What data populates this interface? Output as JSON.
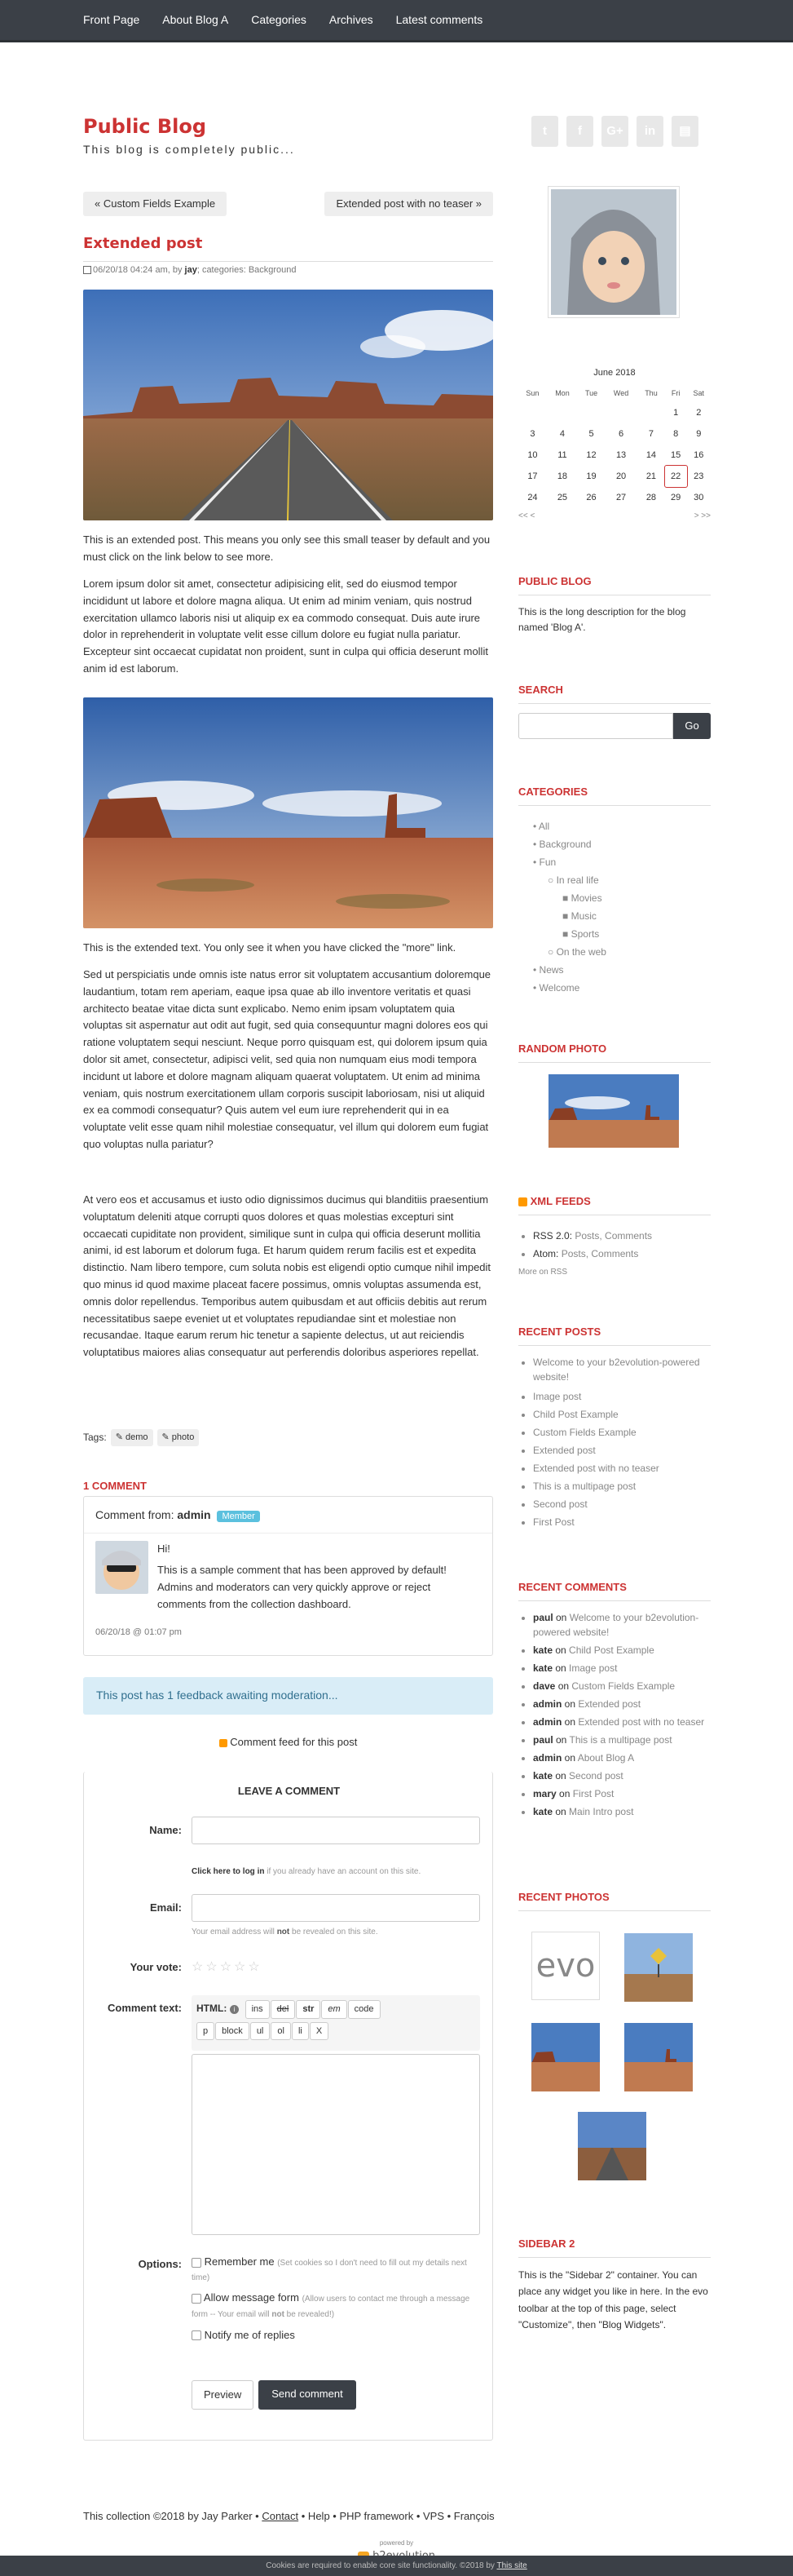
{
  "nav": {
    "items": [
      "Front Page",
      "About Blog A",
      "Categories",
      "Archives",
      "Latest comments"
    ]
  },
  "header": {
    "title": "Public Blog",
    "subtitle": "This blog is completely public..."
  },
  "social": [
    "twitter-icon",
    "facebook-icon",
    "googleplus-icon",
    "linkedin-icon",
    "print-icon"
  ],
  "pagenav": {
    "prev": "« Custom Fields Example",
    "next": "Extended post with no teaser »"
  },
  "post": {
    "title": "Extended post",
    "meta_date": "06/20/18 04:24 am, by ",
    "meta_author": "jay",
    "meta_cat_label": "; categories: ",
    "meta_cat": "Background",
    "teaser": "This is an extended post. This means you only see this small teaser by default and you must click on the link below to see more.",
    "lorem1": "Lorem ipsum dolor sit amet, consectetur adipisicing elit, sed do eiusmod tempor incididunt ut labore et dolore magna aliqua. Ut enim ad minim veniam, quis nostrud exercitation ullamco laboris nisi ut aliquip ex ea commodo consequat. Duis aute irure dolor in reprehenderit in voluptate velit esse cillum dolore eu fugiat nulla pariatur. Excepteur sint occaecat cupidatat non proident, sunt in culpa qui officia deserunt mollit anim id est laborum.",
    "extended": "This is the extended text. You only see it when you have clicked the \"more\" link.",
    "sed": "Sed ut perspiciatis unde omnis iste natus error sit voluptatem accusantium doloremque laudantium, totam rem aperiam, eaque ipsa quae ab illo inventore veritatis et quasi architecto beatae vitae dicta sunt explicabo. Nemo enim ipsam voluptatem quia voluptas sit aspernatur aut odit aut fugit, sed quia consequuntur magni dolores eos qui ratione voluptatem sequi nesciunt. Neque porro quisquam est, qui dolorem ipsum quia dolor sit amet, consectetur, adipisci velit, sed quia non numquam eius modi tempora incidunt ut labore et dolore magnam aliquam quaerat voluptatem. Ut enim ad minima veniam, quis nostrum exercitationem ullam corporis suscipit laboriosam, nisi ut aliquid ex ea commodi consequatur? Quis autem vel eum iure reprehenderit qui in ea voluptate velit esse quam nihil molestiae consequatur, vel illum qui dolorem eum fugiat quo voluptas nulla pariatur?",
    "at_vero": "At vero eos et accusamus et iusto odio dignissimos ducimus qui blanditiis praesentium voluptatum deleniti atque corrupti quos dolores et quas molestias excepturi sint occaecati cupiditate non provident, similique sunt in culpa qui officia deserunt mollitia animi, id est laborum et dolorum fuga. Et harum quidem rerum facilis est et expedita distinctio. Nam libero tempore, cum soluta nobis est eligendi optio cumque nihil impedit quo minus id quod maxime placeat facere possimus, omnis voluptas assumenda est, omnis dolor repellendus. Temporibus autem quibusdam et aut officiis debitis aut rerum necessitatibus saepe eveniet ut et voluptates repudiandae sint et molestiae non recusandae. Itaque earum rerum hic tenetur a sapiente delectus, ut aut reiciendis voluptatibus maiores alias consequatur aut perferendis doloribus asperiores repellat.",
    "tags_label": "Tags:",
    "tags": [
      "demo",
      "photo"
    ]
  },
  "comments": {
    "heading": "1 COMMENT",
    "from_label": "Comment from: ",
    "author": "admin",
    "badge": "Member",
    "hi": "Hi!",
    "body": "This is a sample comment that has been approved by default! Admins and moderators can very quickly approve or reject comments from the collection dashboard.",
    "date": "06/20/18 @ 01:07 pm",
    "moderation": "This post has 1 feedback awaiting moderation...",
    "feed": "Comment feed for this post"
  },
  "form": {
    "heading": "LEAVE A COMMENT",
    "name_label": "Name:",
    "login_link": "Click here to log in",
    "login_hint": " if you already have an account on this site.",
    "email_label": "Email:",
    "email_hint_pre": "Your email address will ",
    "email_hint_not": "not",
    "email_hint_post": " be revealed on this site.",
    "vote_label": "Your vote:",
    "comment_label": "Comment text:",
    "html_label": "HTML:",
    "toolbar1": [
      "ins",
      "del",
      "str",
      "em",
      "code"
    ],
    "toolbar2": [
      "p",
      "block",
      "ul",
      "ol",
      "li",
      "X"
    ],
    "options_label": "Options:",
    "opt1": "Remember me",
    "opt1_hint": "(Set cookies so I don't need to fill out my details next time)",
    "opt2": "Allow message form",
    "opt2_hint": "(Allow users to contact me through a message form -- Your email will ",
    "opt2_hint_not": "not",
    "opt2_hint_post": " be revealed!)",
    "opt3": "Notify me of replies",
    "preview": "Preview",
    "send": "Send comment"
  },
  "calendar": {
    "title": "June 2018",
    "days": [
      "Sun",
      "Mon",
      "Tue",
      "Wed",
      "Thu",
      "Fri",
      "Sat"
    ],
    "weeks": [
      [
        "",
        "",
        "",
        "",
        "",
        "1",
        "2"
      ],
      [
        "3",
        "4",
        "5",
        "6",
        "7",
        "8",
        "9"
      ],
      [
        "10",
        "11",
        "12",
        "13",
        "14",
        "15",
        "16"
      ],
      [
        "17",
        "18",
        "19",
        "20",
        "21",
        "22",
        "23"
      ],
      [
        "24",
        "25",
        "26",
        "27",
        "28",
        "29",
        "30"
      ]
    ],
    "today": "22",
    "prev": "<<  <",
    "next": ">  >>"
  },
  "sidebar": {
    "public_blog_h": "PUBLIC BLOG",
    "public_blog_text": "This is the long description for the blog named 'Blog A'.",
    "search_h": "SEARCH",
    "search_btn": "Go",
    "categories_h": "CATEGORIES",
    "categories": [
      "All",
      "Background",
      "Fun",
      "In real life",
      "Movies",
      "Music",
      "Sports",
      "On the web",
      "News",
      "Welcome"
    ],
    "random_photo_h": "RANDOM PHOTO",
    "xml_h": "XML FEEDS",
    "rss_label": "RSS 2.0: ",
    "atom_label": "Atom: ",
    "posts": "Posts",
    "comments": "Comments",
    "more_rss": "More on RSS",
    "recent_posts_h": "RECENT POSTS",
    "recent_posts": [
      "Welcome to your b2evolution-powered website!",
      "Image post",
      "Child Post Example",
      "Custom Fields Example",
      "Extended post",
      "Extended post with no teaser",
      "This is a multipage post",
      "Second post",
      "First Post"
    ],
    "recent_comments_h": "RECENT COMMENTS",
    "recent_comments": [
      {
        "n": "paul",
        "l": "Welcome to your b2evolution-powered website!"
      },
      {
        "n": "kate",
        "l": "Child Post Example"
      },
      {
        "n": "kate",
        "l": "Image post"
      },
      {
        "n": "dave",
        "l": "Custom Fields Example"
      },
      {
        "n": "admin",
        "l": "Extended post"
      },
      {
        "n": "admin",
        "l": "Extended post with no teaser"
      },
      {
        "n": "paul",
        "l": "This is a multipage post"
      },
      {
        "n": "admin",
        "l": "About Blog A"
      },
      {
        "n": "kate",
        "l": "Second post"
      },
      {
        "n": "mary",
        "l": "First Post"
      },
      {
        "n": "kate",
        "l": "Main Intro post"
      }
    ],
    "recent_photos_h": "RECENT PHOTOS",
    "evo_text": "evo",
    "sidebar2_h": "SIDEBAR 2",
    "sidebar2_text": "This is the \"Sidebar 2\" container. You can place any widget you like in here. In the evo toolbar at the top of this page, select \"Customize\", then \"Blog Widgets\"."
  },
  "footer": {
    "text": "This collection ©2018 by Jay Parker • ",
    "contact": "Contact",
    "rest": " • Help • PHP framework • VPS • François",
    "powered": "powered by",
    "brand": "b2evolution",
    "cookies_pre": "Cookies are required to enable core site functionality. ©2018 by ",
    "cookies_link": "This site"
  }
}
